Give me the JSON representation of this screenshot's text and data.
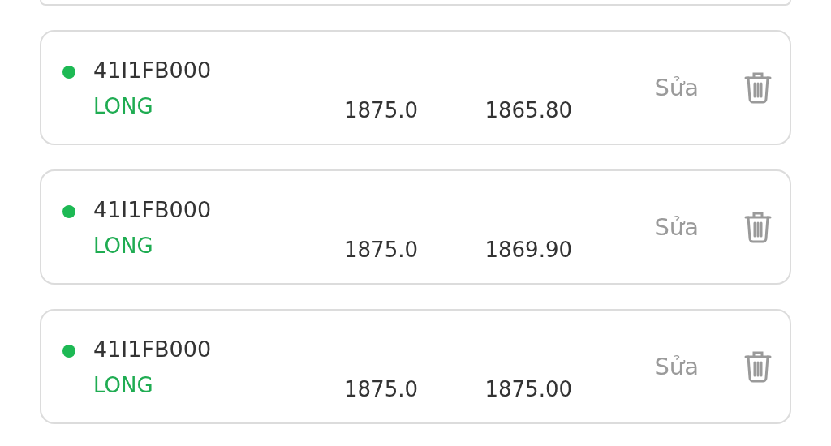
{
  "orders": [
    {
      "symbol": "41I1FB000",
      "side": "LONG",
      "color": "#1db954",
      "price_1": "1875.0",
      "price_2": "1865.80",
      "edit": "Sửa"
    },
    {
      "symbol": "41I1FB000",
      "side": "LONG",
      "color": "#1db954",
      "price_1": "1875.0",
      "price_2": "1869.90",
      "edit": "Sửa"
    },
    {
      "symbol": "41I1FB000",
      "side": "LONG",
      "color": "#1db954",
      "price_1": "1875.0",
      "price_2": "1875.00",
      "edit": "Sửa"
    }
  ]
}
